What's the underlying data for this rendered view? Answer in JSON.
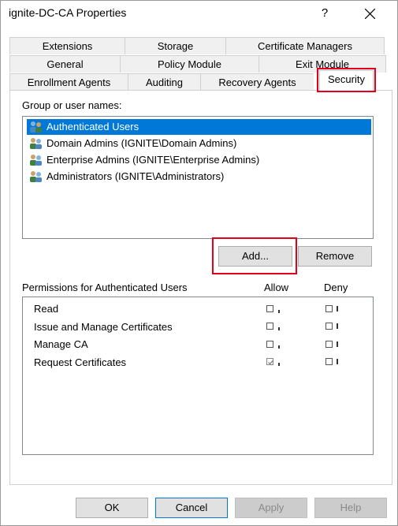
{
  "window": {
    "title": "ignite-DC-CA Properties",
    "help_glyph": "?",
    "close_icon": "close-icon"
  },
  "tabs": {
    "row1": [
      "Extensions",
      "Storage",
      "Certificate Managers"
    ],
    "row2": [
      "General",
      "Policy Module",
      "Exit Module"
    ],
    "row3": [
      "Enrollment Agents",
      "Auditing",
      "Recovery Agents",
      "Security"
    ],
    "active": "Security"
  },
  "security": {
    "group_label": "Group or user names:",
    "users": [
      {
        "name": "Authenticated Users",
        "icon": "users-group-icon",
        "selected": true
      },
      {
        "name": "Domain Admins (IGNITE\\Domain Admins)",
        "icon": "users-group-icon",
        "selected": false
      },
      {
        "name": "Enterprise Admins (IGNITE\\Enterprise Admins)",
        "icon": "users-group-icon",
        "selected": false
      },
      {
        "name": "Administrators (IGNITE\\Administrators)",
        "icon": "users-group-icon",
        "selected": false
      }
    ],
    "add_label": "Add...",
    "remove_label": "Remove",
    "permissions_label": "Permissions for Authenticated Users",
    "allow_header": "Allow",
    "deny_header": "Deny",
    "permissions": [
      {
        "name": "Read",
        "allow": false,
        "deny": false
      },
      {
        "name": "Issue and Manage Certificates",
        "allow": false,
        "deny": false
      },
      {
        "name": "Manage CA",
        "allow": false,
        "deny": false
      },
      {
        "name": "Request Certificates",
        "allow": true,
        "deny": false
      }
    ]
  },
  "footer": {
    "ok_label": "OK",
    "cancel_label": "Cancel",
    "apply_label": "Apply",
    "help_label": "Help"
  },
  "colors": {
    "selection": "#0078d7",
    "annotation": "#e3001b"
  }
}
